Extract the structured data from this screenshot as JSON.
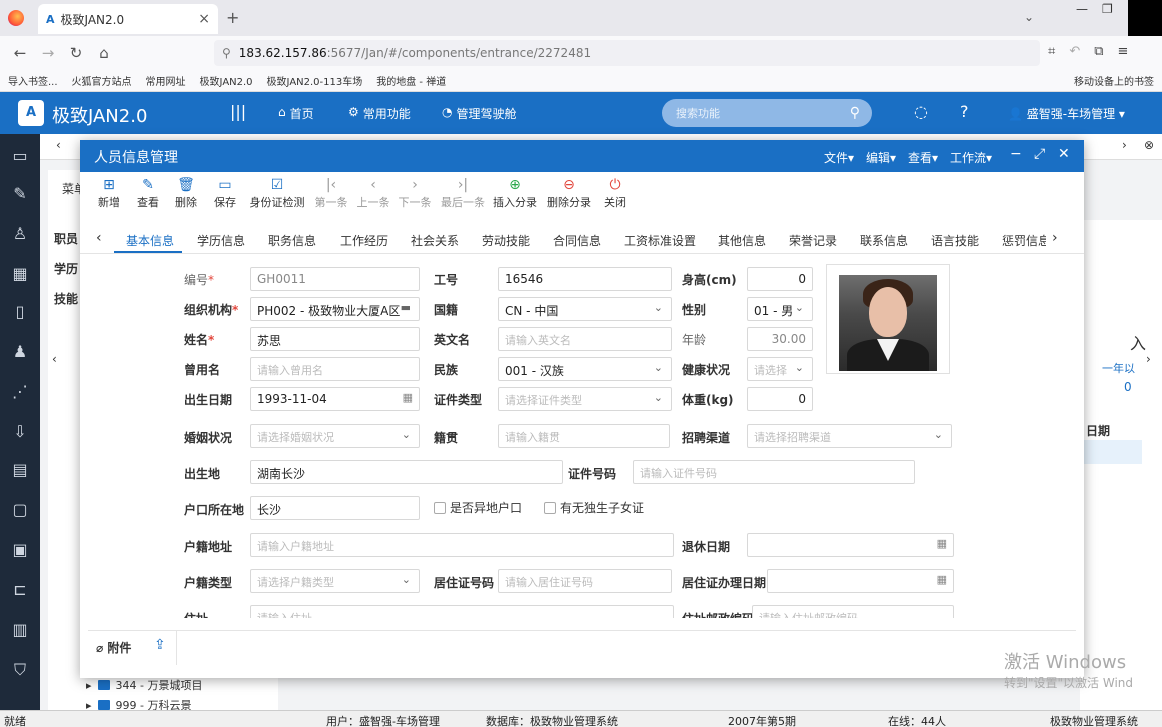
{
  "browser": {
    "tab_title": "极致JAN2.0",
    "url_host": "183.62.157.86",
    "url_rest": ":5677/Jan/#/components/entrance/2272481",
    "bookmarks": [
      "导入书签...",
      "火狐官方站点",
      "常用网址",
      "极致JAN2.0",
      "极致JAN2.0-113车场",
      "我的地盘 - 禅道"
    ],
    "bookmarks_right": "移动设备上的书签"
  },
  "app": {
    "logo": "A",
    "title": "极致JAN2.0",
    "menu": [
      "首页",
      "常用功能",
      "管理驾驶舱"
    ],
    "search_placeholder": "搜索功能",
    "user": "盛智强-车场管理"
  },
  "background": {
    "left_labels": [
      "职员",
      "学历",
      "技能"
    ],
    "menu_label": "菜单",
    "right_text": "入",
    "right_text2": "一年以",
    "right_num": "0",
    "right_col": "日期",
    "tree": [
      "344 - 万景城项目",
      "999 - 万科云景"
    ]
  },
  "modal": {
    "title": "人员信息管理",
    "menus": [
      "文件",
      "编辑",
      "查看",
      "工作流"
    ],
    "toolbar": [
      {
        "label": "新增",
        "icon": "add-icon",
        "enabled": true
      },
      {
        "label": "查看",
        "icon": "edit-icon",
        "enabled": true
      },
      {
        "label": "删除",
        "icon": "trash-icon",
        "enabled": true
      },
      {
        "label": "保存",
        "icon": "save-icon",
        "enabled": true
      },
      {
        "label": "身份证检测",
        "icon": "check-icon",
        "enabled": true
      },
      {
        "label": "第一条",
        "icon": "first-icon",
        "enabled": false
      },
      {
        "label": "上一条",
        "icon": "prev-icon",
        "enabled": false
      },
      {
        "label": "下一条",
        "icon": "next-icon",
        "enabled": false
      },
      {
        "label": "最后一条",
        "icon": "last-icon",
        "enabled": false
      },
      {
        "label": "插入分录",
        "icon": "plus-circle-icon",
        "enabled": true
      },
      {
        "label": "删除分录",
        "icon": "minus-circle-icon",
        "enabled": true
      },
      {
        "label": "关闭",
        "icon": "power-icon",
        "enabled": true
      }
    ],
    "tabs": [
      "基本信息",
      "学历信息",
      "职务信息",
      "工作经历",
      "社会关系",
      "劳动技能",
      "合同信息",
      "工资标准设置",
      "其他信息",
      "荣誉记录",
      "联系信息",
      "语言技能",
      "惩罚信息"
    ],
    "active_tab": "基本信息",
    "form": {
      "code_label": "编号",
      "code_value": "GH0011",
      "job_no_label": "工号",
      "job_no_value": "16546",
      "height_label": "身高(cm)",
      "height_value": "0",
      "org_label": "组织机构",
      "org_value": "PH002 - 极致物业大厦A区",
      "nation_label": "国籍",
      "nation_value": "CN - 中国",
      "gender_label": "性别",
      "gender_value": "01 - 男",
      "name_label": "姓名",
      "name_value": "苏思",
      "en_name_label": "英文名",
      "en_name_placeholder": "请输入英文名",
      "age_label": "年龄",
      "age_value": "30.00",
      "former_label": "曾用名",
      "former_placeholder": "请输入曾用名",
      "ethnic_label": "民族",
      "ethnic_value": "001 - 汉族",
      "health_label": "健康状况",
      "health_placeholder": "请选择",
      "birth_label": "出生日期",
      "birth_value": "1993-11-04",
      "idtype_label": "证件类型",
      "idtype_placeholder": "请选择证件类型",
      "weight_label": "体重(kg)",
      "weight_value": "0",
      "marital_label": "婚姻状况",
      "marital_placeholder": "请选择婚姻状况",
      "origin_label": "籍贯",
      "origin_placeholder": "请输入籍贯",
      "channel_label": "招聘渠道",
      "channel_placeholder": "请选择招聘渠道",
      "birthplace_label": "出生地",
      "birthplace_value": "湖南长沙",
      "idno_label": "证件号码",
      "idno_placeholder": "请输入证件号码",
      "hukou_label": "户口所在地",
      "hukou_value": "长沙",
      "nonlocal_label": "是否异地户口",
      "onechild_label": "有无独生子女证",
      "hukou_addr_label": "户籍地址",
      "hukou_addr_placeholder": "请输入户籍地址",
      "retire_label": "退休日期",
      "hukou_type_label": "户籍类型",
      "hukou_type_placeholder": "请选择户籍类型",
      "residence_label": "居住证号码",
      "residence_placeholder": "请输入居住证号码",
      "residence_date_label": "居住证办理日期",
      "addr_label": "住址",
      "addr_placeholder": "请输入住址",
      "zip_label": "住址邮政编码",
      "zip_placeholder": "请输入住址邮政编码"
    },
    "attachment_label": "附件"
  },
  "status": {
    "left": "就绪",
    "user": "用户：盛智强-车场管理",
    "db": "数据库：极致物业管理系统",
    "period": "2007年第5期",
    "online": "在线：44人",
    "system": "极致物业管理系统"
  },
  "watermark": {
    "line1": "激活 Windows",
    "line2": "转到\"设置\"以激活 Wind"
  }
}
